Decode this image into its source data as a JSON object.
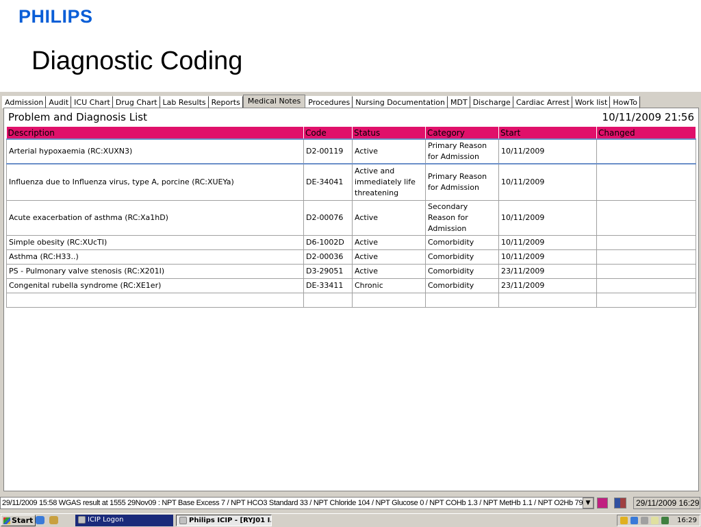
{
  "header": {
    "brand": "PHILIPS",
    "title": "Diagnostic Coding"
  },
  "tabs": [
    "Admission",
    "Audit",
    "ICU Chart",
    "Drug Chart",
    "Lab Results",
    "Reports",
    "Medical  Notes",
    "Procedures",
    "Nursing Documentation",
    "MDT",
    "Discharge",
    "Cardiac Arrest",
    "Work list",
    "HowTo"
  ],
  "active_tab": "Medical  Notes",
  "panel": {
    "title": "Problem and Diagnosis List",
    "datetime": "10/11/2009  21:56"
  },
  "table": {
    "columns": [
      "Description",
      "Code",
      "Status",
      "Category",
      "Start",
      "Changed"
    ],
    "rows": [
      [
        "Arterial hypoxaemia (RC:XUXN3)",
        "D2-00119",
        "Active",
        "Primary Reason for Admission",
        "10/11/2009",
        ""
      ],
      [
        "Influenza due to Influenza virus, type A, porcine (RC:XUEYa)",
        "DE-34041",
        "Active and immediately life threatening",
        "Primary Reason for Admission",
        "10/11/2009",
        ""
      ],
      [
        "Acute exacerbation of asthma (RC:Xa1hD)",
        "D2-00076",
        "Active",
        "Secondary Reason for Admission",
        "10/11/2009",
        ""
      ],
      [
        "Simple obesity (RC:XUcTI)",
        "D6-1002D",
        "Active",
        "Comorbidity",
        "10/11/2009",
        ""
      ],
      [
        "Asthma (RC:H33..)",
        "D2-00036",
        "Active",
        "Comorbidity",
        "10/11/2009",
        ""
      ],
      [
        "PS - Pulmonary valve stenosis (RC:X201I)",
        "D3-29051",
        "Active",
        "Comorbidity",
        "23/11/2009",
        ""
      ],
      [
        "Congenital rubella syndrome (RC:XE1er)",
        "DE-33411",
        "Chronic",
        "Comorbidity",
        "23/11/2009",
        ""
      ],
      [
        "",
        "",
        "",
        "",
        "",
        ""
      ]
    ]
  },
  "statusbar": {
    "message": "29/11/2009 15:58 WGAS result at 1555 29Nov09 : NPT Base Excess 7 / NPT HCO3 Standard 33 / NPT Chloride 104 / NPT Glucose 0 / NPT COHb 1.3 / NPT MetHb 1.1 / NPT O2Hb 79 / ...",
    "datetime": "29/11/2009 16:29"
  },
  "taskbar": {
    "start_label": "Start",
    "tasks": [
      "ICIP Logon",
      "Philips ICIP - [RYJ01 I..."
    ],
    "clock": "16:29"
  },
  "colors": {
    "brand": "#0a5ed7",
    "header_row": "#e0106a",
    "taskbar_active": "#1a2a7a"
  }
}
